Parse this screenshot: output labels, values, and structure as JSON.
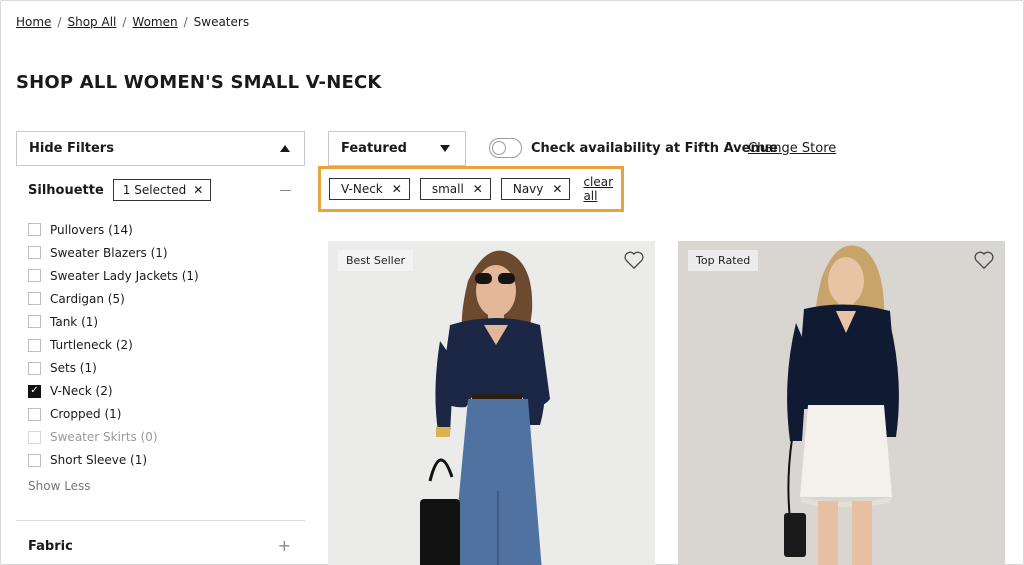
{
  "breadcrumb": {
    "items": [
      "Home",
      "Shop All",
      "Women"
    ],
    "current": "Sweaters",
    "separator": "/"
  },
  "page": {
    "title": "SHOP ALL WOMEN'S SMALL V-NECK"
  },
  "filters": {
    "toggle_label": "Hide Filters",
    "silhouette": {
      "title": "Silhouette",
      "selected_badge": "1 Selected",
      "options": [
        {
          "label": "Pullovers (14)",
          "checked": false,
          "disabled": false
        },
        {
          "label": "Sweater Blazers (1)",
          "checked": false,
          "disabled": false
        },
        {
          "label": "Sweater Lady Jackets (1)",
          "checked": false,
          "disabled": false
        },
        {
          "label": "Cardigan (5)",
          "checked": false,
          "disabled": false
        },
        {
          "label": "Tank (1)",
          "checked": false,
          "disabled": false
        },
        {
          "label": "Turtleneck (2)",
          "checked": false,
          "disabled": false
        },
        {
          "label": "Sets (1)",
          "checked": false,
          "disabled": false
        },
        {
          "label": "V-Neck (2)",
          "checked": true,
          "disabled": false
        },
        {
          "label": "Cropped (1)",
          "checked": false,
          "disabled": false
        },
        {
          "label": "Sweater Skirts (0)",
          "checked": false,
          "disabled": true
        },
        {
          "label": "Short Sleeve (1)",
          "checked": false,
          "disabled": false
        }
      ],
      "show_less": "Show Less"
    },
    "fabric": {
      "title": "Fabric"
    }
  },
  "toolbar": {
    "sort_label": "Featured",
    "availability_label": "Check availability at Fifth Avenue",
    "availability_on": false,
    "change_store": "Change Store"
  },
  "applied_filters": {
    "chips": [
      "V-Neck",
      "small",
      "Navy"
    ],
    "clear_all": "clear all",
    "highlight_color": "#e8a33c"
  },
  "products": [
    {
      "badge": "Best Seller",
      "favorited": false
    },
    {
      "badge": "Top Rated",
      "favorited": false
    }
  ],
  "icons": {
    "remove": "close-icon",
    "collapse": "triangle-up-icon",
    "dropdown": "triangle-down-icon",
    "favorite": "heart-icon",
    "expand": "plus-icon",
    "collapse_section": "minus-icon"
  }
}
